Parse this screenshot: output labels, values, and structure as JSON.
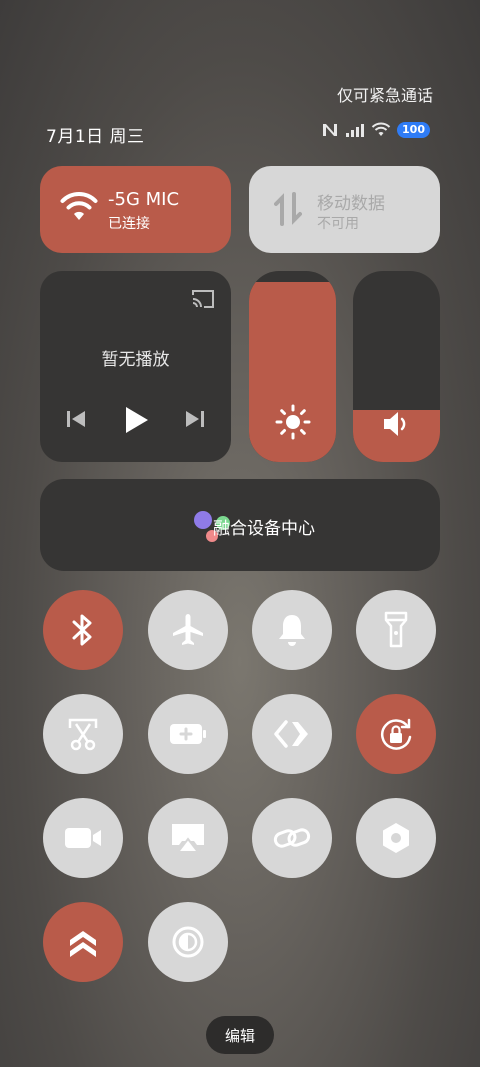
{
  "status": {
    "emergency_text": "仅可紧急通话",
    "date": "7月1日 周三",
    "battery": "100"
  },
  "wifi": {
    "name": "-5G      MIC",
    "status": "已连接"
  },
  "mobile_data": {
    "name": "移动数据",
    "status": "不可用"
  },
  "media": {
    "empty_text": "暂无播放"
  },
  "brightness": {
    "level": 0.94
  },
  "volume": {
    "level": 0.27
  },
  "fusion": {
    "label": "融合设备中心"
  },
  "toggles": [
    {
      "name": "bluetooth",
      "on": true
    },
    {
      "name": "airplane",
      "on": false
    },
    {
      "name": "ring",
      "on": false
    },
    {
      "name": "flashlight",
      "on": false
    },
    {
      "name": "screenshot",
      "on": false
    },
    {
      "name": "battery-saver",
      "on": false
    },
    {
      "name": "nearby-share",
      "on": false
    },
    {
      "name": "rotation-lock",
      "on": true
    },
    {
      "name": "screen-record",
      "on": false
    },
    {
      "name": "screen-cast",
      "on": false
    },
    {
      "name": "link",
      "on": false
    },
    {
      "name": "settings-hex",
      "on": false
    },
    {
      "name": "performance",
      "on": true
    },
    {
      "name": "dark-mode",
      "on": false
    }
  ],
  "edit_label": "编辑",
  "colors": {
    "accent": "#b95b4a",
    "tile_dark": "#363534",
    "tile_light": "#d7d7d7"
  }
}
